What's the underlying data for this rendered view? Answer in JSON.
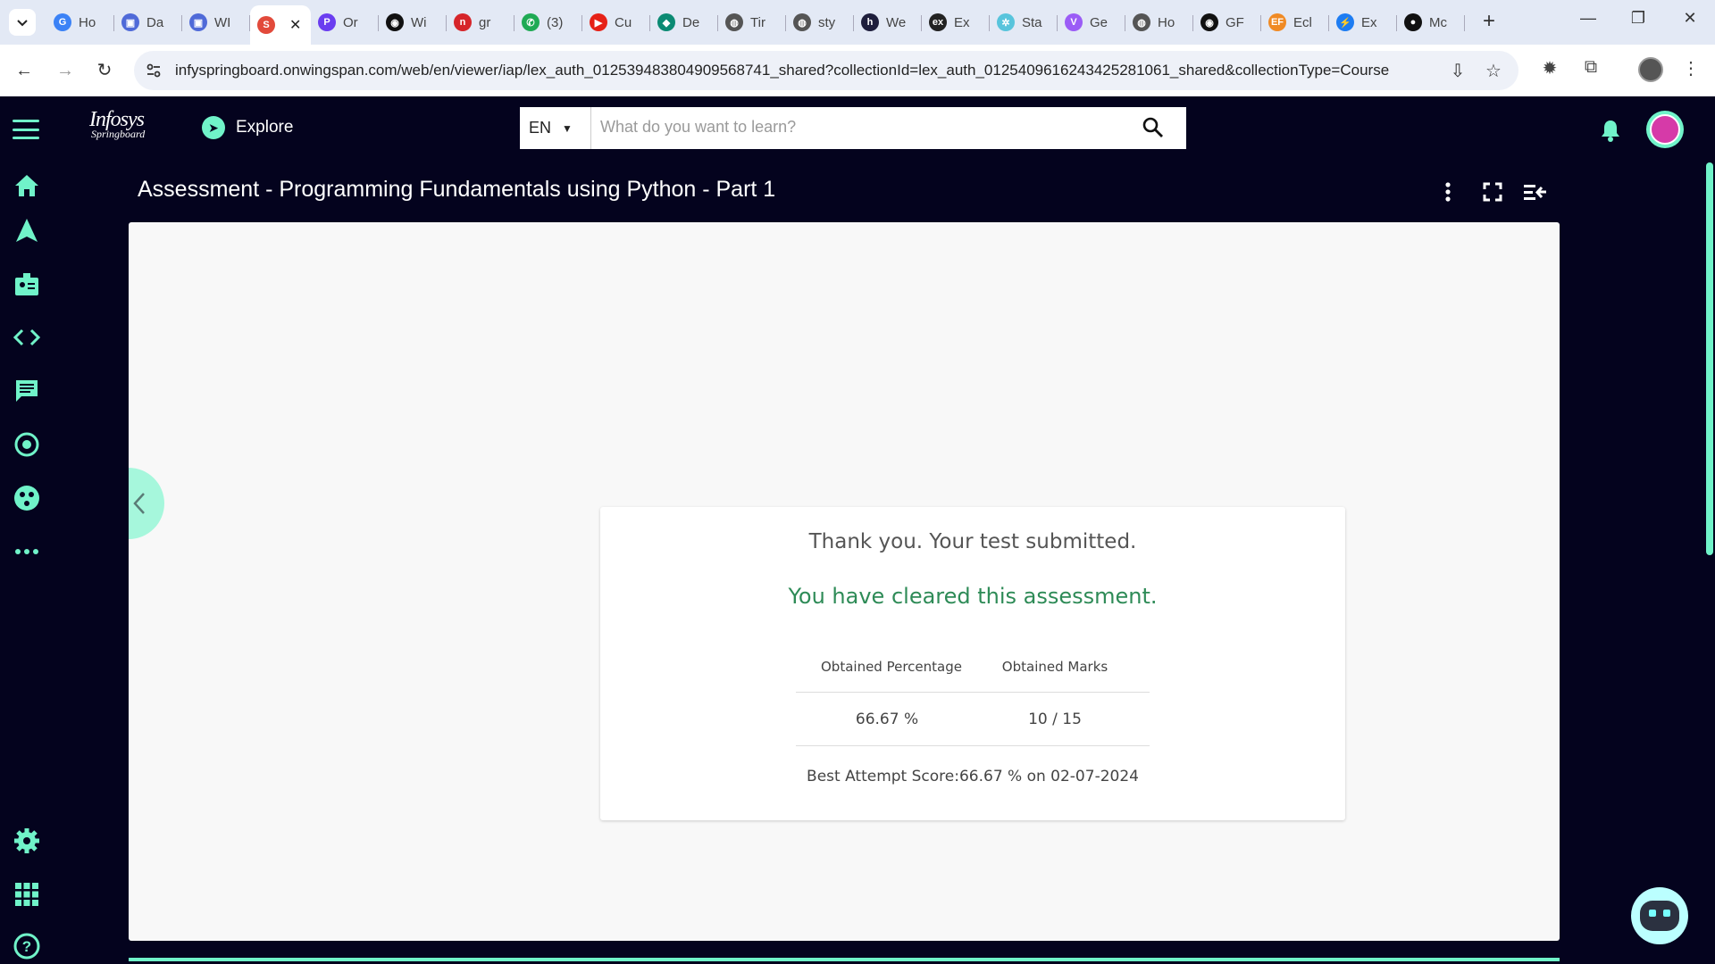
{
  "browser": {
    "tabs": [
      {
        "label": "Ho",
        "color": "#3b82f6",
        "glyph": "G"
      },
      {
        "label": "Da",
        "color": "#4f6ad8",
        "glyph": "▣"
      },
      {
        "label": "WI",
        "color": "#4f6ad8",
        "glyph": "▣"
      },
      {
        "label": "",
        "color": "#e24a3b",
        "glyph": "S",
        "active": true
      },
      {
        "label": "Or",
        "color": "#6a3df0",
        "glyph": "P"
      },
      {
        "label": "Wi",
        "color": "#111111",
        "glyph": "◉"
      },
      {
        "label": "gr",
        "color": "#d6252a",
        "glyph": "n"
      },
      {
        "label": "(3)",
        "color": "#1faa54",
        "glyph": "✆"
      },
      {
        "label": "Cu",
        "color": "#e62117",
        "glyph": "▶"
      },
      {
        "label": "De",
        "color": "#0b8a73",
        "glyph": "◆"
      },
      {
        "label": "Tir",
        "color": "#555555",
        "glyph": "◍"
      },
      {
        "label": "sty",
        "color": "#555555",
        "glyph": "◍"
      },
      {
        "label": "We",
        "color": "#1e1e3c",
        "glyph": "h"
      },
      {
        "label": "Ex",
        "color": "#222222",
        "glyph": "ex"
      },
      {
        "label": "Sta",
        "color": "#58c4dc",
        "glyph": "✲"
      },
      {
        "label": "Ge",
        "color": "#9b5cf6",
        "glyph": "V"
      },
      {
        "label": "Ho",
        "color": "#555555",
        "glyph": "◍"
      },
      {
        "label": "GF",
        "color": "#111111",
        "glyph": "◉"
      },
      {
        "label": "Ecl",
        "color": "#f08a24",
        "glyph": "EF"
      },
      {
        "label": "Ex",
        "color": "#1d7cf2",
        "glyph": "⚡"
      },
      {
        "label": "Mc",
        "color": "#111111",
        "glyph": "●"
      }
    ],
    "url": "infyspringboard.onwingspan.com/web/en/viewer/iap/lex_auth_012539483804909568741_shared?collectionId=lex_auth_0125409616243425281061_shared&collectionType=Course",
    "new_tab": "+",
    "close_tab": "✕"
  },
  "header": {
    "logo_line1": "Infosys",
    "logo_line2": "Springboard",
    "explore_label": "Explore",
    "language": "EN",
    "search_placeholder": "What do you want to learn?"
  },
  "rail": {
    "icons": [
      "home-icon",
      "navigate-icon",
      "badge-icon",
      "code-icon",
      "chat-icon",
      "target-icon",
      "community-icon",
      "more-icon",
      "settings-icon",
      "apps-icon",
      "help-icon"
    ]
  },
  "viewer": {
    "title": "Assessment - Programming Fundamentals using Python - Part 1"
  },
  "result": {
    "thanks": "Thank you. Your test submitted.",
    "status": "You have cleared this assessment.",
    "col_percentage": "Obtained Percentage",
    "col_marks": "Obtained Marks",
    "percentage": "66.67 %",
    "marks": "10 / 15",
    "best_attempt": "Best Attempt Score:66.67 % on 02-07-2024"
  },
  "colors": {
    "accent": "#70f3c9",
    "background": "#04031e",
    "success": "#2e8b57"
  }
}
